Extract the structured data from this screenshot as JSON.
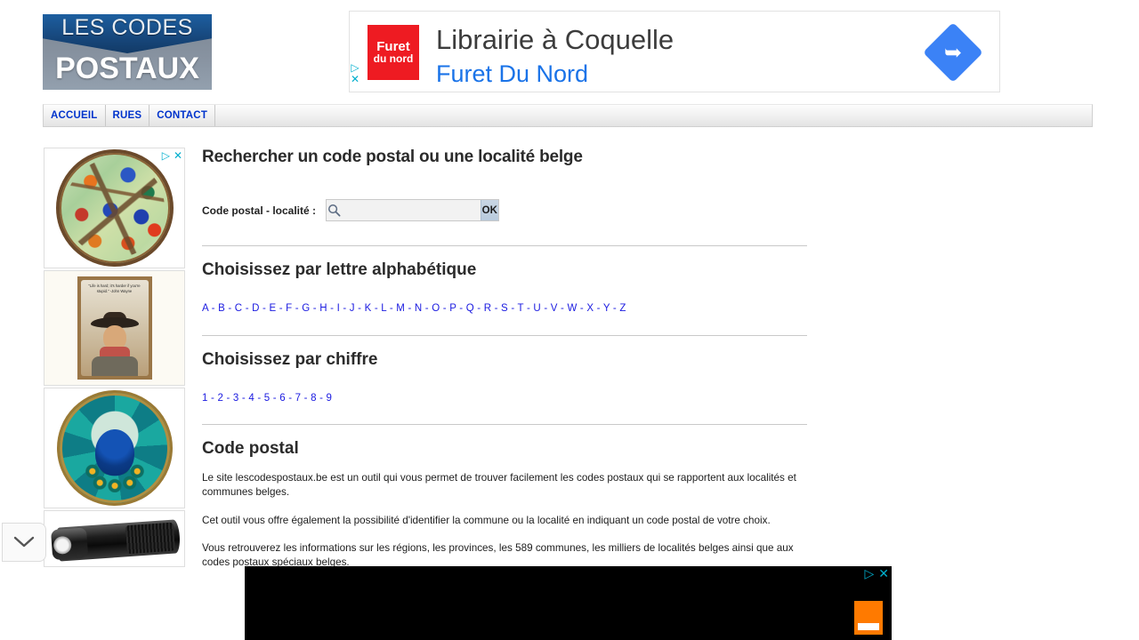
{
  "site": {
    "logo_line1": "LES CODES",
    "logo_line2": "POSTAUX"
  },
  "top_ad": {
    "brand_line1": "Furet",
    "brand_line2": "du nord",
    "headline": "Librairie à Coquelle",
    "advertiser": "Furet Du Nord",
    "arrow_glyph": "➥",
    "adchoices_triangle": "▷",
    "adchoices_close": "✕"
  },
  "nav": {
    "items": [
      {
        "label": "ACCUEIL",
        "name": "nav-item-accueil"
      },
      {
        "label": "RUES",
        "name": "nav-item-rues"
      },
      {
        "label": "CONTACT",
        "name": "nav-item-contact"
      }
    ]
  },
  "side_ads": {
    "adchoices_triangle": "▷",
    "adchoices_close": "✕",
    "poster_quote": "\"Life is hard; it's harder if you're stupid.\" -John Wayne"
  },
  "main": {
    "page_title": "Rechercher un code postal ou une localité belge",
    "search": {
      "label": "Code postal - localité :",
      "value": "",
      "placeholder": "",
      "submit_label": "OK",
      "icon": "search-icon"
    },
    "alpha_section": {
      "title": "Choisissez par lettre alphabétique",
      "letters": [
        "A",
        "B",
        "C",
        "D",
        "E",
        "F",
        "G",
        "H",
        "I",
        "J",
        "K",
        "L",
        "M",
        "N",
        "O",
        "P",
        "Q",
        "R",
        "S",
        "T",
        "U",
        "V",
        "W",
        "X",
        "Y",
        "Z"
      ],
      "separator": " - "
    },
    "digit_section": {
      "title": "Choisissez par chiffre",
      "digits": [
        "1",
        "2",
        "3",
        "4",
        "5",
        "6",
        "7",
        "8",
        "9"
      ],
      "separator": " - "
    },
    "info_section": {
      "title": "Code postal",
      "paragraph1": "Le site lescodespostaux.be est un outil qui vous permet de trouver facilement les codes postaux qui se rapportent aux localités et communes belges.",
      "paragraph2": "Cet outil vous offre également la possibilité d'identifier la commune ou la localité en indiquant un code postal de votre choix.",
      "paragraph3": "Vous retrouverez les informations sur les régions, les provinces, les 589 communes, les milliers de localités belges ainsi que aux codes postaux spéciaux belges."
    }
  },
  "bottom_ad": {
    "adchoices_triangle": "▷",
    "adchoices_close": "✕"
  },
  "colors": {
    "logo_blue": "#17477c",
    "logo_gray": "#8792a0",
    "nav_link": "#0033cc",
    "content_link": "#1a1ae0",
    "ad_blue": "#1a73e8",
    "ad_red": "#ee1b22",
    "orange": "#ff7a00",
    "adchoices_cyan": "#00aecd"
  }
}
